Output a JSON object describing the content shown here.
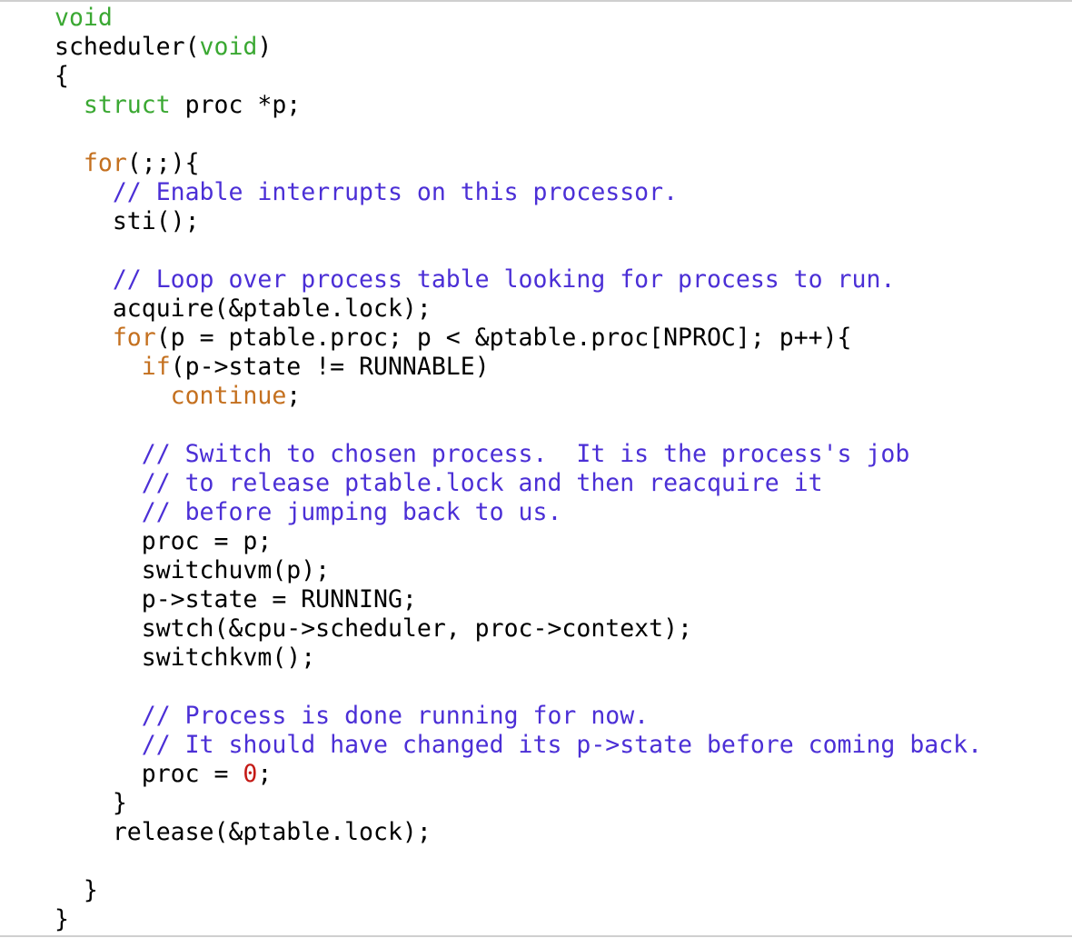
{
  "editor": {
    "colors": {
      "background": "#ffffff",
      "plain": "#000000",
      "keyword_type": "#3aa832",
      "keyword_control": "#c4701f",
      "comment": "#4b2fd6",
      "number": "#c41a16"
    },
    "lines": [
      {
        "indent": 0,
        "tokens": [
          {
            "t": "void",
            "k": "kw-type"
          }
        ]
      },
      {
        "indent": 0,
        "tokens": [
          {
            "t": "scheduler(",
            "k": "plain"
          },
          {
            "t": "void",
            "k": "kw-type"
          },
          {
            "t": ")",
            "k": "plain"
          }
        ]
      },
      {
        "indent": 0,
        "tokens": [
          {
            "t": "{",
            "k": "plain"
          }
        ]
      },
      {
        "indent": 1,
        "tokens": [
          {
            "t": "struct",
            "k": "kw-type"
          },
          {
            "t": " proc *p;",
            "k": "plain"
          }
        ]
      },
      {
        "indent": 0,
        "tokens": []
      },
      {
        "indent": 1,
        "tokens": [
          {
            "t": "for",
            "k": "kw-ctrl"
          },
          {
            "t": "(;;){",
            "k": "plain"
          }
        ]
      },
      {
        "indent": 2,
        "tokens": [
          {
            "t": "// Enable interrupts on this processor.",
            "k": "comment"
          }
        ]
      },
      {
        "indent": 2,
        "tokens": [
          {
            "t": "sti();",
            "k": "plain"
          }
        ]
      },
      {
        "indent": 0,
        "tokens": []
      },
      {
        "indent": 2,
        "tokens": [
          {
            "t": "// Loop over process table looking for process to run.",
            "k": "comment"
          }
        ]
      },
      {
        "indent": 2,
        "tokens": [
          {
            "t": "acquire(&ptable.lock);",
            "k": "plain"
          }
        ]
      },
      {
        "indent": 2,
        "tokens": [
          {
            "t": "for",
            "k": "kw-ctrl"
          },
          {
            "t": "(p = ptable.proc; p < &ptable.proc[NPROC]; p++){",
            "k": "plain"
          }
        ]
      },
      {
        "indent": 3,
        "tokens": [
          {
            "t": "if",
            "k": "kw-ctrl"
          },
          {
            "t": "(p->state != RUNNABLE)",
            "k": "plain"
          }
        ]
      },
      {
        "indent": 4,
        "tokens": [
          {
            "t": "continue",
            "k": "kw-ctrl"
          },
          {
            "t": ";",
            "k": "plain"
          }
        ]
      },
      {
        "indent": 0,
        "tokens": []
      },
      {
        "indent": 3,
        "tokens": [
          {
            "t": "// Switch to chosen process.  It is the process's job",
            "k": "comment"
          }
        ]
      },
      {
        "indent": 3,
        "tokens": [
          {
            "t": "// to release ptable.lock and then reacquire it",
            "k": "comment"
          }
        ]
      },
      {
        "indent": 3,
        "tokens": [
          {
            "t": "// before jumping back to us.",
            "k": "comment"
          }
        ]
      },
      {
        "indent": 3,
        "tokens": [
          {
            "t": "proc = p;",
            "k": "plain"
          }
        ]
      },
      {
        "indent": 3,
        "tokens": [
          {
            "t": "switchuvm(p);",
            "k": "plain"
          }
        ]
      },
      {
        "indent": 3,
        "tokens": [
          {
            "t": "p->state = RUNNING;",
            "k": "plain"
          }
        ]
      },
      {
        "indent": 3,
        "tokens": [
          {
            "t": "swtch(&cpu->scheduler, proc->context);",
            "k": "plain"
          }
        ]
      },
      {
        "indent": 3,
        "tokens": [
          {
            "t": "switchkvm();",
            "k": "plain"
          }
        ]
      },
      {
        "indent": 0,
        "tokens": []
      },
      {
        "indent": 3,
        "tokens": [
          {
            "t": "// Process is done running for now.",
            "k": "comment"
          }
        ]
      },
      {
        "indent": 3,
        "tokens": [
          {
            "t": "// It should have changed its p->state before coming back.",
            "k": "comment"
          }
        ]
      },
      {
        "indent": 3,
        "tokens": [
          {
            "t": "proc = ",
            "k": "plain"
          },
          {
            "t": "0",
            "k": "num"
          },
          {
            "t": ";",
            "k": "plain"
          }
        ]
      },
      {
        "indent": 2,
        "tokens": [
          {
            "t": "}",
            "k": "plain"
          }
        ]
      },
      {
        "indent": 2,
        "tokens": [
          {
            "t": "release(&ptable.lock);",
            "k": "plain"
          }
        ]
      },
      {
        "indent": 0,
        "tokens": []
      },
      {
        "indent": 1,
        "tokens": [
          {
            "t": "}",
            "k": "plain"
          }
        ]
      },
      {
        "indent": 0,
        "tokens": [
          {
            "t": "}",
            "k": "plain"
          }
        ]
      }
    ]
  }
}
